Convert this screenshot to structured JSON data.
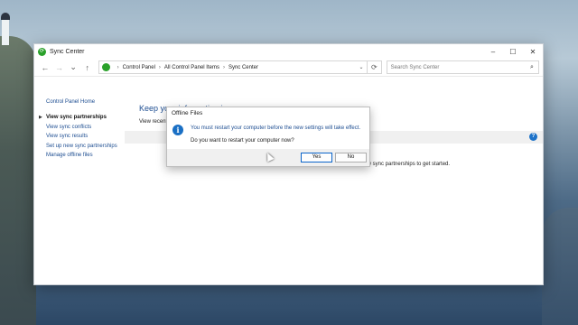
{
  "window": {
    "title": "Sync Center",
    "controls": {
      "minimize": "–",
      "maximize": "☐",
      "close": "✕"
    }
  },
  "addressbar": {
    "back": "←",
    "forward": "→",
    "recent": "⌄",
    "up": "↑",
    "breadcrumbs": [
      "Control Panel",
      "All Control Panel Items",
      "Sync Center"
    ],
    "separator": "›",
    "dropdown": "⌄",
    "refresh": "⟳",
    "search_placeholder": "Search Sync Center",
    "search_glyph": "⌕"
  },
  "sidebar": {
    "home": "Control Panel Home",
    "items": [
      {
        "label": "View sync partnerships",
        "active": true
      },
      {
        "label": "View sync conflicts"
      },
      {
        "label": "View sync results"
      },
      {
        "label": "Set up new sync partnerships"
      },
      {
        "label": "Manage offline files"
      }
    ]
  },
  "main": {
    "title": "Keep your information in sync",
    "description": "View recent sync activity, sync now, or change your sync settings.",
    "note": "new sync partnerships to get started.",
    "help_glyph": "?"
  },
  "dialog": {
    "title": "Offline Files",
    "info_glyph": "i",
    "message": "You must restart your computer before the new settings will take effect.",
    "question": "Do you want to restart your computer now?",
    "yes_label": "Yes",
    "no_label": "No"
  },
  "colors": {
    "accent": "#1d4d91",
    "sync_icon": "#2aa12a",
    "info_icon": "#1a6fc4"
  }
}
